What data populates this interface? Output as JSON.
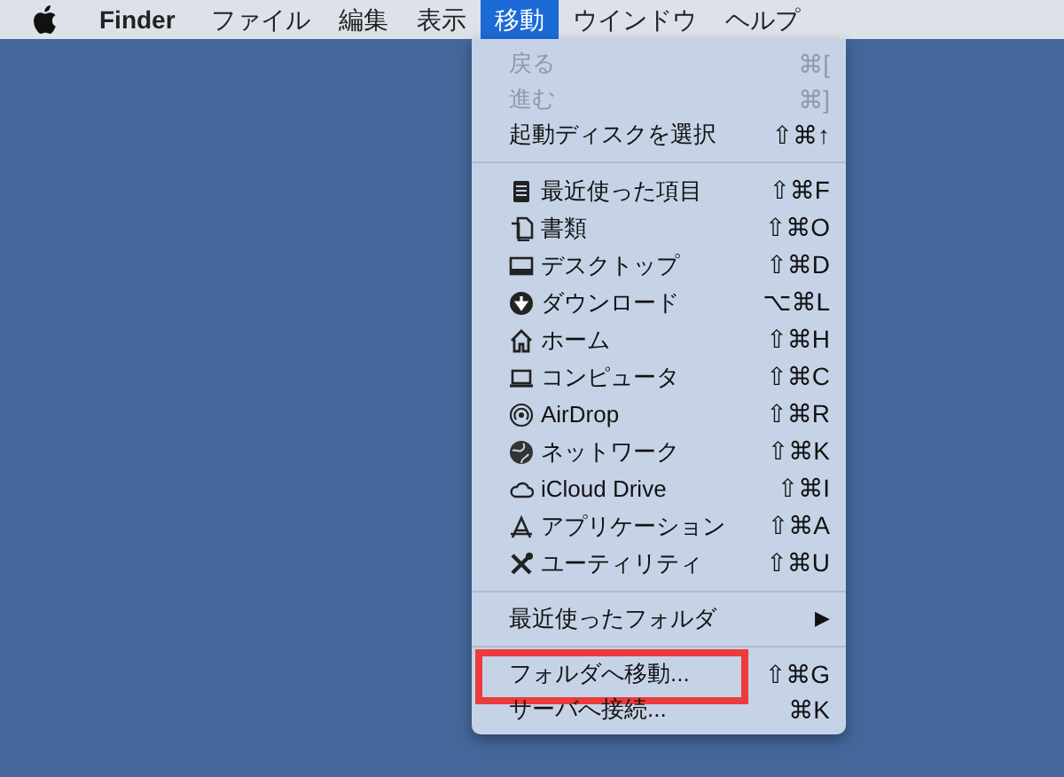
{
  "menubar": [
    {
      "label": "Finder",
      "kind": "app",
      "selected": false
    },
    {
      "label": "ファイル",
      "kind": "menu",
      "selected": false
    },
    {
      "label": "編集",
      "kind": "menu",
      "selected": false
    },
    {
      "label": "表示",
      "kind": "menu",
      "selected": false
    },
    {
      "label": "移動",
      "kind": "menu",
      "selected": true
    },
    {
      "label": "ウインドウ",
      "kind": "menu",
      "selected": false
    },
    {
      "label": "ヘルプ",
      "kind": "menu",
      "selected": false
    }
  ],
  "menu": [
    {
      "kind": "item",
      "label": "戻る",
      "shortcut": "⌘[",
      "disabled": true,
      "highlighted": false
    },
    {
      "kind": "item",
      "label": "進む",
      "shortcut": "⌘]",
      "disabled": true,
      "highlighted": false
    },
    {
      "kind": "item",
      "label": "起動ディスクを選択",
      "shortcut": "⇧⌘↑",
      "disabled": false,
      "highlighted": false
    },
    {
      "kind": "separator"
    },
    {
      "kind": "place",
      "label": "最近使った項目",
      "shortcut": "⇧⌘F",
      "disabled": false,
      "highlighted": false
    },
    {
      "kind": "place",
      "label": "書類",
      "shortcut": "⇧⌘O",
      "disabled": false,
      "highlighted": false
    },
    {
      "kind": "place",
      "label": "デスクトップ",
      "shortcut": "⇧⌘D",
      "disabled": false,
      "highlighted": false
    },
    {
      "kind": "place",
      "label": "ダウンロード",
      "shortcut": "⌥⌘L",
      "disabled": false,
      "highlighted": false
    },
    {
      "kind": "place",
      "label": "ホーム",
      "shortcut": "⇧⌘H",
      "disabled": false,
      "highlighted": false
    },
    {
      "kind": "place",
      "label": "コンピュータ",
      "shortcut": "⇧⌘C",
      "disabled": false,
      "highlighted": false
    },
    {
      "kind": "place",
      "label": "AirDrop",
      "shortcut": "⇧⌘R",
      "disabled": false,
      "highlighted": false
    },
    {
      "kind": "place",
      "label": "ネットワーク",
      "shortcut": "⇧⌘K",
      "disabled": false,
      "highlighted": false
    },
    {
      "kind": "place",
      "label": "iCloud Drive",
      "shortcut": "⇧⌘I",
      "disabled": false,
      "highlighted": false
    },
    {
      "kind": "place",
      "label": "アプリケーション",
      "shortcut": "⇧⌘A",
      "disabled": false,
      "highlighted": false
    },
    {
      "kind": "place",
      "label": "ユーティリティ",
      "shortcut": "⇧⌘U",
      "disabled": false,
      "highlighted": false
    },
    {
      "kind": "separator"
    },
    {
      "kind": "submenu",
      "label": "最近使ったフォルダ",
      "shortcut": "▶",
      "disabled": false,
      "highlighted": false
    },
    {
      "kind": "separator"
    },
    {
      "kind": "item",
      "label": "フォルダへ移動...",
      "shortcut": "⇧⌘G",
      "disabled": false,
      "highlighted": true
    },
    {
      "kind": "item",
      "label": "サーバへ接続...",
      "shortcut": "⌘K",
      "disabled": false,
      "highlighted": false
    }
  ]
}
